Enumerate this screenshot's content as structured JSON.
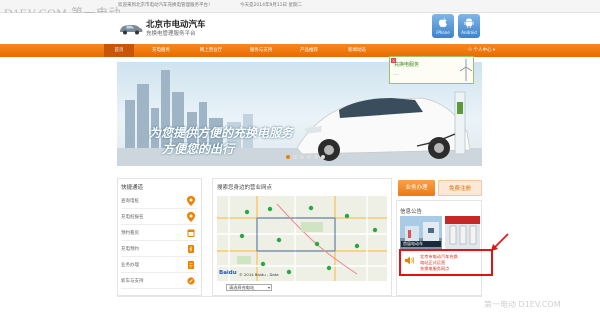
{
  "watermark": {
    "left": "D1EV.COM 第一电动",
    "bottom_right": "第一电动 D1EV.COM"
  },
  "topbar": {
    "welcome": "欢迎来到北京市电动汽车充换电管理服务平台！",
    "date": "今天是2014年9月11日 星期二"
  },
  "logo": {
    "title": "北京市电动汽车",
    "subtitle": "充换电管理服务平台"
  },
  "apps": [
    {
      "label": "iPhone",
      "icon": "apple-icon"
    },
    {
      "label": "Android",
      "icon": "android-icon"
    }
  ],
  "nav": {
    "items": [
      "首页",
      "充电服务",
      "网上营业厅",
      "服务与支持",
      "产品推荐",
      "新闻动态"
    ],
    "active": 0,
    "user": "个人中心"
  },
  "banner": {
    "line1": "为您提供方便的充换电服务",
    "line2": "方便您的出行",
    "slides": 6,
    "active_slide": 0
  },
  "popup": {
    "line1": "充换电服务",
    "line2": "..."
  },
  "quick": {
    "title": "快捷通道",
    "items": [
      "查询电桩",
      "充电桩报名",
      "预约看房",
      "充电预约",
      "业务办理",
      "新车与支持"
    ]
  },
  "map_panel": {
    "title": "搜索您身边的营业网点",
    "select_value": "请选择充电站",
    "map_logo": "Baidu",
    "map_copyright": "© 2014 Baidu - Data"
  },
  "service": {
    "btn_primary": "业务办理",
    "btn_secondary": "免费注册"
  },
  "news": {
    "title": "信息公告",
    "photo_caption": "首届电动车",
    "notice_lines": [
      "北京市电动汽车充换",
      "电站正式运营",
      "充换电服务网点"
    ]
  },
  "colors": {
    "orange": "#f08000",
    "nav": "#f7871f",
    "highlight": "#e41313"
  }
}
